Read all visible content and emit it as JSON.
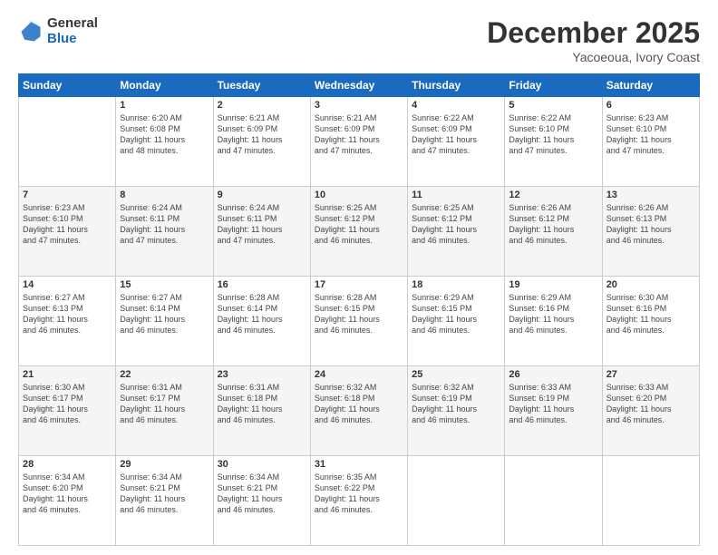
{
  "header": {
    "logo_general": "General",
    "logo_blue": "Blue",
    "month_title": "December 2025",
    "subtitle": "Yacoeoua, Ivory Coast"
  },
  "days_of_week": [
    "Sunday",
    "Monday",
    "Tuesday",
    "Wednesday",
    "Thursday",
    "Friday",
    "Saturday"
  ],
  "weeks": [
    [
      {
        "day": "",
        "info": ""
      },
      {
        "day": "1",
        "info": "Sunrise: 6:20 AM\nSunset: 6:08 PM\nDaylight: 11 hours\nand 48 minutes."
      },
      {
        "day": "2",
        "info": "Sunrise: 6:21 AM\nSunset: 6:09 PM\nDaylight: 11 hours\nand 47 minutes."
      },
      {
        "day": "3",
        "info": "Sunrise: 6:21 AM\nSunset: 6:09 PM\nDaylight: 11 hours\nand 47 minutes."
      },
      {
        "day": "4",
        "info": "Sunrise: 6:22 AM\nSunset: 6:09 PM\nDaylight: 11 hours\nand 47 minutes."
      },
      {
        "day": "5",
        "info": "Sunrise: 6:22 AM\nSunset: 6:10 PM\nDaylight: 11 hours\nand 47 minutes."
      },
      {
        "day": "6",
        "info": "Sunrise: 6:23 AM\nSunset: 6:10 PM\nDaylight: 11 hours\nand 47 minutes."
      }
    ],
    [
      {
        "day": "7",
        "info": "Sunrise: 6:23 AM\nSunset: 6:10 PM\nDaylight: 11 hours\nand 47 minutes."
      },
      {
        "day": "8",
        "info": "Sunrise: 6:24 AM\nSunset: 6:11 PM\nDaylight: 11 hours\nand 47 minutes."
      },
      {
        "day": "9",
        "info": "Sunrise: 6:24 AM\nSunset: 6:11 PM\nDaylight: 11 hours\nand 47 minutes."
      },
      {
        "day": "10",
        "info": "Sunrise: 6:25 AM\nSunset: 6:12 PM\nDaylight: 11 hours\nand 46 minutes."
      },
      {
        "day": "11",
        "info": "Sunrise: 6:25 AM\nSunset: 6:12 PM\nDaylight: 11 hours\nand 46 minutes."
      },
      {
        "day": "12",
        "info": "Sunrise: 6:26 AM\nSunset: 6:12 PM\nDaylight: 11 hours\nand 46 minutes."
      },
      {
        "day": "13",
        "info": "Sunrise: 6:26 AM\nSunset: 6:13 PM\nDaylight: 11 hours\nand 46 minutes."
      }
    ],
    [
      {
        "day": "14",
        "info": "Sunrise: 6:27 AM\nSunset: 6:13 PM\nDaylight: 11 hours\nand 46 minutes."
      },
      {
        "day": "15",
        "info": "Sunrise: 6:27 AM\nSunset: 6:14 PM\nDaylight: 11 hours\nand 46 minutes."
      },
      {
        "day": "16",
        "info": "Sunrise: 6:28 AM\nSunset: 6:14 PM\nDaylight: 11 hours\nand 46 minutes."
      },
      {
        "day": "17",
        "info": "Sunrise: 6:28 AM\nSunset: 6:15 PM\nDaylight: 11 hours\nand 46 minutes."
      },
      {
        "day": "18",
        "info": "Sunrise: 6:29 AM\nSunset: 6:15 PM\nDaylight: 11 hours\nand 46 minutes."
      },
      {
        "day": "19",
        "info": "Sunrise: 6:29 AM\nSunset: 6:16 PM\nDaylight: 11 hours\nand 46 minutes."
      },
      {
        "day": "20",
        "info": "Sunrise: 6:30 AM\nSunset: 6:16 PM\nDaylight: 11 hours\nand 46 minutes."
      }
    ],
    [
      {
        "day": "21",
        "info": "Sunrise: 6:30 AM\nSunset: 6:17 PM\nDaylight: 11 hours\nand 46 minutes."
      },
      {
        "day": "22",
        "info": "Sunrise: 6:31 AM\nSunset: 6:17 PM\nDaylight: 11 hours\nand 46 minutes."
      },
      {
        "day": "23",
        "info": "Sunrise: 6:31 AM\nSunset: 6:18 PM\nDaylight: 11 hours\nand 46 minutes."
      },
      {
        "day": "24",
        "info": "Sunrise: 6:32 AM\nSunset: 6:18 PM\nDaylight: 11 hours\nand 46 minutes."
      },
      {
        "day": "25",
        "info": "Sunrise: 6:32 AM\nSunset: 6:19 PM\nDaylight: 11 hours\nand 46 minutes."
      },
      {
        "day": "26",
        "info": "Sunrise: 6:33 AM\nSunset: 6:19 PM\nDaylight: 11 hours\nand 46 minutes."
      },
      {
        "day": "27",
        "info": "Sunrise: 6:33 AM\nSunset: 6:20 PM\nDaylight: 11 hours\nand 46 minutes."
      }
    ],
    [
      {
        "day": "28",
        "info": "Sunrise: 6:34 AM\nSunset: 6:20 PM\nDaylight: 11 hours\nand 46 minutes."
      },
      {
        "day": "29",
        "info": "Sunrise: 6:34 AM\nSunset: 6:21 PM\nDaylight: 11 hours\nand 46 minutes."
      },
      {
        "day": "30",
        "info": "Sunrise: 6:34 AM\nSunset: 6:21 PM\nDaylight: 11 hours\nand 46 minutes."
      },
      {
        "day": "31",
        "info": "Sunrise: 6:35 AM\nSunset: 6:22 PM\nDaylight: 11 hours\nand 46 minutes."
      },
      {
        "day": "",
        "info": ""
      },
      {
        "day": "",
        "info": ""
      },
      {
        "day": "",
        "info": ""
      }
    ]
  ]
}
